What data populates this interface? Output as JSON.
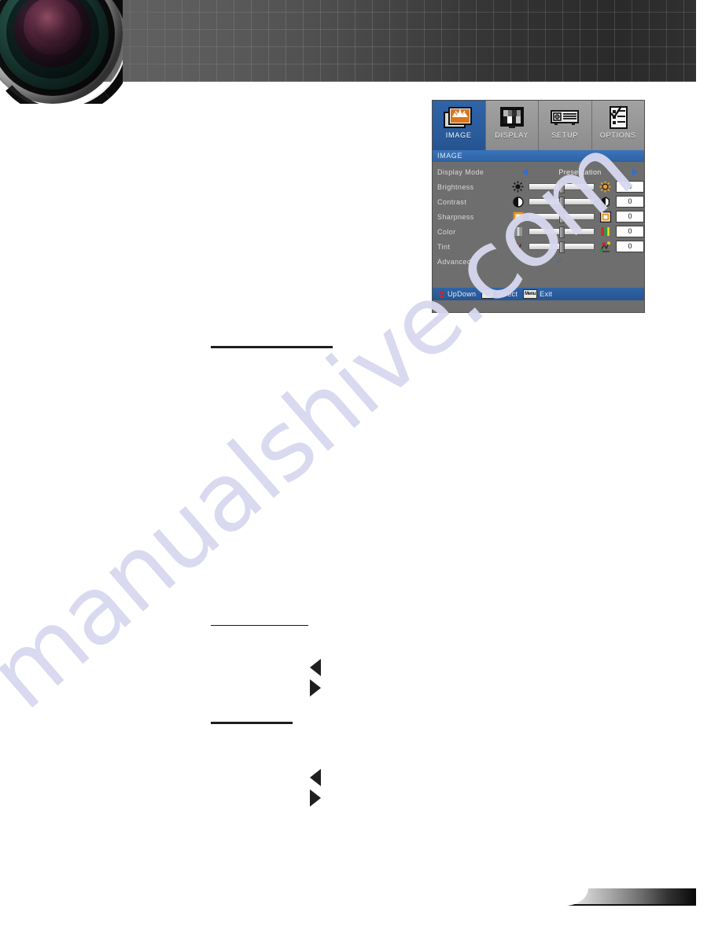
{
  "page": {
    "watermark": "manualshive.com"
  },
  "header": {
    "banner_name": "projector-lens-banner"
  },
  "osd": {
    "tabs": [
      {
        "label": "IMAGE",
        "icon": "image-tab-icon",
        "active": true
      },
      {
        "label": "DISPLAY",
        "icon": "display-tab-icon",
        "active": false
      },
      {
        "label": "SETUP",
        "icon": "setup-tab-icon",
        "active": false
      },
      {
        "label": "OPTIONS",
        "icon": "options-tab-icon",
        "active": false
      }
    ],
    "title": "IMAGE",
    "display_mode": {
      "label": "Display Mode",
      "value": "Presentation",
      "left_arrow": "left-arrow-icon",
      "right_arrow": "right-arrow-icon"
    },
    "sliders": [
      {
        "label": "Brightness",
        "value": "0",
        "icon_left": "brightness-low-icon",
        "icon_right": "brightness-high-icon"
      },
      {
        "label": "Contrast",
        "value": "0",
        "icon_left": "contrast-low-icon",
        "icon_right": "contrast-high-icon"
      },
      {
        "label": "Sharpness",
        "value": "0",
        "icon_left": "sharpness-low-icon",
        "icon_right": "sharpness-high-icon"
      },
      {
        "label": "Color",
        "value": "0",
        "icon_left": "color-low-icon",
        "icon_right": "color-high-icon"
      },
      {
        "label": "Tint",
        "value": "0",
        "icon_left": "tint-low-icon",
        "icon_right": "tint-high-icon"
      }
    ],
    "advanced": {
      "label": "Advanced",
      "enter_mark": "↵"
    },
    "footer": [
      {
        "label": "UpDown",
        "key": "updown-key-icon"
      },
      {
        "label": "Select",
        "key": "enter-key-icon",
        "glyph": "↵"
      },
      {
        "label": "Exit",
        "key": "menu-key-icon",
        "glyph": "Menu"
      }
    ],
    "colors": {
      "accent_blue": "#2f64a8",
      "panel_gray": "#6e6e6e",
      "tab_gray": "#9a9a9a",
      "arrow_blue": "#2f6fd0"
    }
  }
}
